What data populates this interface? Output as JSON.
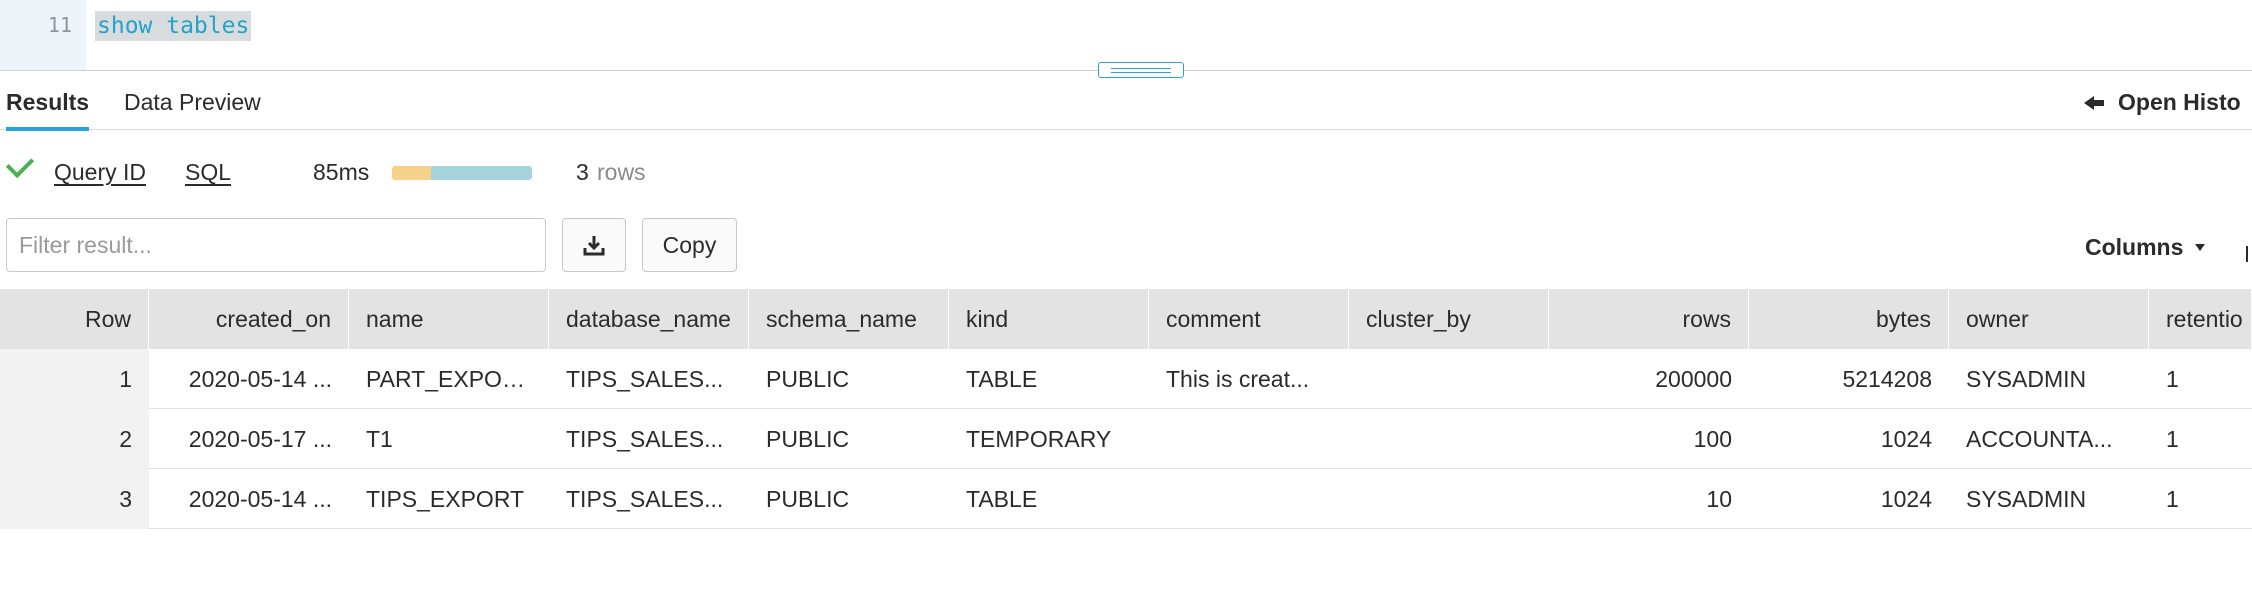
{
  "editor": {
    "line_number": "11",
    "code": "show tables"
  },
  "tabs": [
    {
      "label": "Results",
      "active": true
    },
    {
      "label": "Data Preview",
      "active": false
    }
  ],
  "open_history": {
    "label": "Open Histo"
  },
  "summary": {
    "query_id_label": "Query ID",
    "sql_label": "SQL",
    "duration": "85ms",
    "progress": [
      0.28,
      0.72
    ],
    "row_count": "3",
    "rows_label": "rows",
    "status_icon": "check-icon"
  },
  "toolbar": {
    "filter_placeholder": "Filter result...",
    "download_icon": "download-icon",
    "copy_label": "Copy",
    "columns_label": "Columns"
  },
  "table": {
    "headers": [
      "Row",
      "created_on",
      "name",
      "database_name",
      "schema_name",
      "kind",
      "comment",
      "cluster_by",
      "rows",
      "bytes",
      "owner",
      "retentio"
    ],
    "rows": [
      [
        "1",
        "2020-05-14 ...",
        "PART_EXPORT",
        "TIPS_SALES...",
        "PUBLIC",
        "TABLE",
        "This is creat...",
        "",
        "200000",
        "5214208",
        "SYSADMIN",
        "1"
      ],
      [
        "2",
        "2020-05-17 ...",
        "T1",
        "TIPS_SALES...",
        "PUBLIC",
        "TEMPORARY",
        "",
        "",
        "100",
        "1024",
        "ACCOUNTA...",
        "1"
      ],
      [
        "3",
        "2020-05-14 ...",
        "TIPS_EXPORT",
        "TIPS_SALES...",
        "PUBLIC",
        "TABLE",
        "",
        "",
        "10",
        "1024",
        "SYSADMIN",
        "1"
      ]
    ]
  },
  "colors": {
    "accent": "#29a3d6",
    "success": "#4caf50",
    "progress_compile": "#f6d28a",
    "progress_exec": "#a7d3df"
  }
}
